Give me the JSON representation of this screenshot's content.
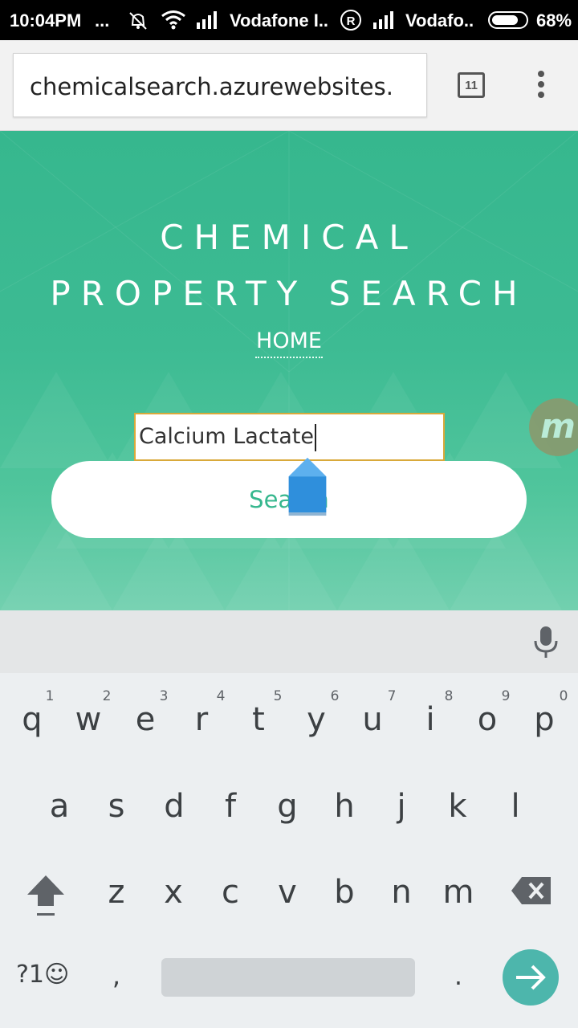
{
  "status_bar": {
    "time": "10:04PM",
    "dots": "...",
    "carrier1": "Vodafone I..",
    "roaming": "R",
    "carrier2": "Vodafo..",
    "battery": "68%"
  },
  "browser": {
    "url": "chemicalsearch.azurewebsites.",
    "tab_count": "11"
  },
  "page": {
    "title_line1": "CHEMICAL",
    "title_line2": "PROPERTY SEARCH",
    "home_link": "HOME",
    "search_value": "Calcium Lactate",
    "search_button": "Search"
  },
  "bubble": {
    "letter": "m"
  },
  "keyboard": {
    "row1": [
      "q",
      "w",
      "e",
      "r",
      "t",
      "y",
      "u",
      "i",
      "o",
      "p"
    ],
    "row1_hints": [
      "1",
      "2",
      "3",
      "4",
      "5",
      "6",
      "7",
      "8",
      "9",
      "0"
    ],
    "row2": [
      "a",
      "s",
      "d",
      "f",
      "g",
      "h",
      "j",
      "k",
      "l"
    ],
    "row3": [
      "z",
      "x",
      "c",
      "v",
      "b",
      "n",
      "m"
    ],
    "symbols_key": "?1☺",
    "comma": ",",
    "period": "."
  },
  "colors": {
    "hero": "#3dbb93",
    "accent": "#36b78e",
    "enter_key": "#4db6ac",
    "selection_handle": "#2f8fdc"
  }
}
